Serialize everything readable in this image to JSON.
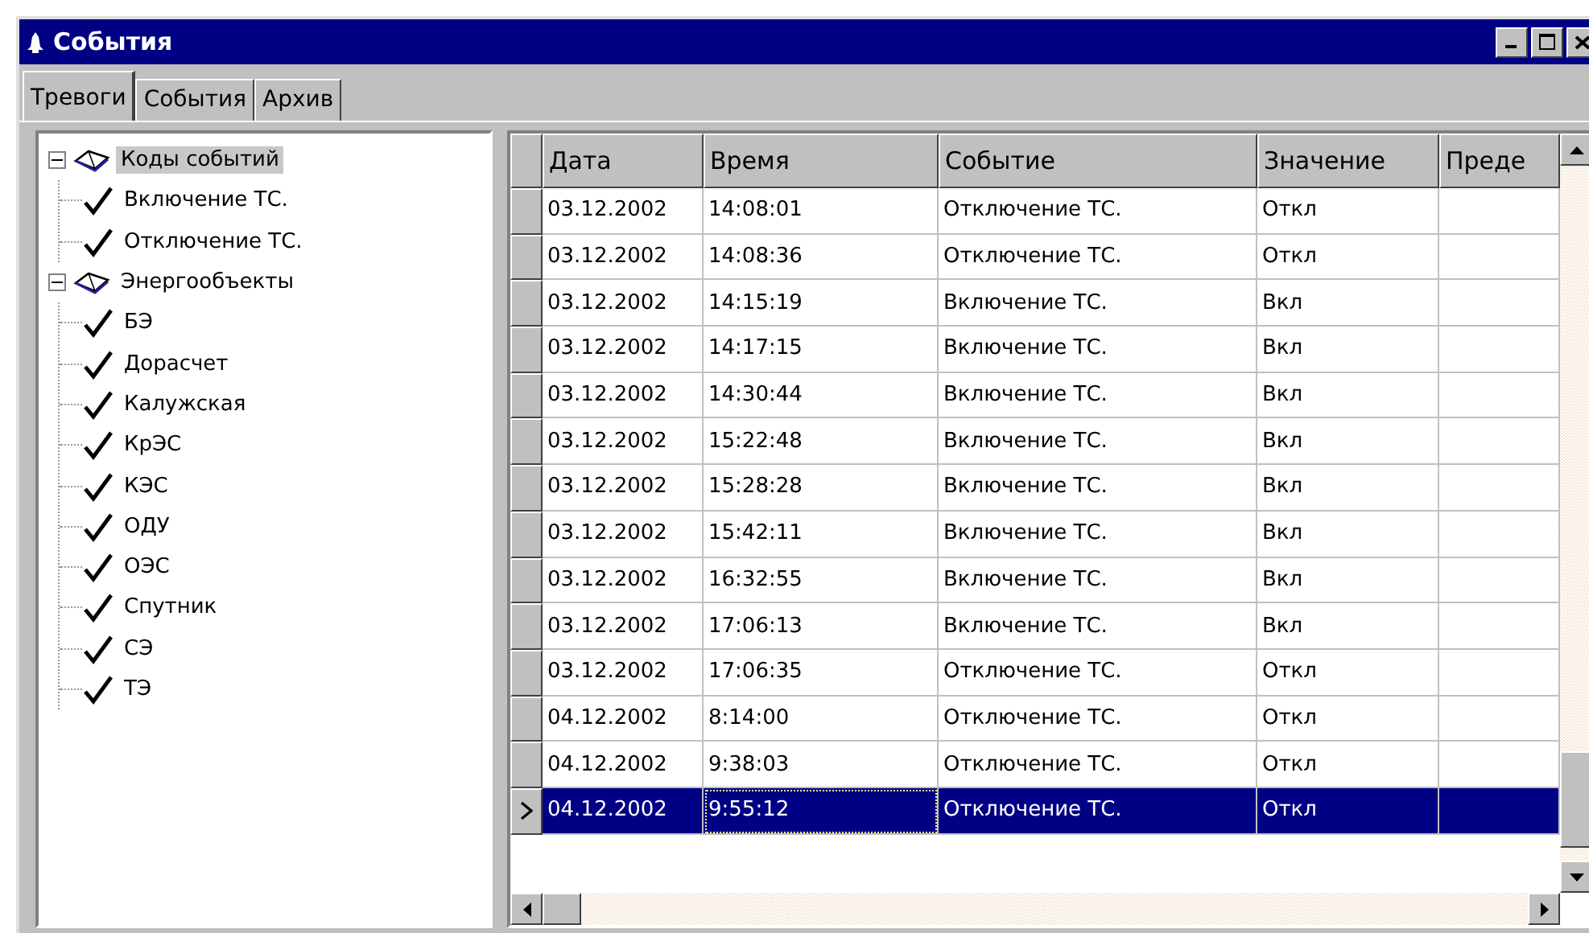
{
  "window": {
    "title": "События"
  },
  "tabs": [
    {
      "label": "Тревоги",
      "selected": true
    },
    {
      "label": "События",
      "selected": false
    },
    {
      "label": "Архив",
      "selected": false
    }
  ],
  "tree": [
    {
      "label": "Коды событий",
      "expanded": true,
      "selected": true,
      "children": [
        {
          "label": "Включение ТС.",
          "checked": true
        },
        {
          "label": "Отключение ТС.",
          "checked": true
        }
      ]
    },
    {
      "label": "Энергообъекты",
      "expanded": true,
      "selected": false,
      "children": [
        {
          "label": "БЭ",
          "checked": true
        },
        {
          "label": "Дорасчет",
          "checked": true
        },
        {
          "label": "Калужская",
          "checked": true
        },
        {
          "label": "КрЭС",
          "checked": true
        },
        {
          "label": "КЭС",
          "checked": true
        },
        {
          "label": "ОДУ",
          "checked": true
        },
        {
          "label": "ОЭС",
          "checked": true
        },
        {
          "label": "Спутник",
          "checked": true
        },
        {
          "label": "СЭ",
          "checked": true
        },
        {
          "label": "ТЭ",
          "checked": true
        }
      ]
    }
  ],
  "table": {
    "columns": [
      "Дата",
      "Время",
      "Событие",
      "Значение",
      "Преде"
    ],
    "rows": [
      {
        "cells": [
          "03.12.2002",
          "14:08:01",
          "Отключение ТС.",
          "Откл"
        ],
        "selected": false
      },
      {
        "cells": [
          "03.12.2002",
          "14:08:36",
          "Отключение ТС.",
          "Откл"
        ],
        "selected": false
      },
      {
        "cells": [
          "03.12.2002",
          "14:15:19",
          "Включение ТС.",
          "Вкл"
        ],
        "selected": false
      },
      {
        "cells": [
          "03.12.2002",
          "14:17:15",
          "Включение ТС.",
          "Вкл"
        ],
        "selected": false
      },
      {
        "cells": [
          "03.12.2002",
          "14:30:44",
          "Включение ТС.",
          "Вкл"
        ],
        "selected": false
      },
      {
        "cells": [
          "03.12.2002",
          "15:22:48",
          "Включение ТС.",
          "Вкл"
        ],
        "selected": false
      },
      {
        "cells": [
          "03.12.2002",
          "15:28:28",
          "Включение ТС.",
          "Вкл"
        ],
        "selected": false
      },
      {
        "cells": [
          "03.12.2002",
          "15:42:11",
          "Включение ТС.",
          "Вкл"
        ],
        "selected": false
      },
      {
        "cells": [
          "03.12.2002",
          "16:32:55",
          "Включение ТС.",
          "Вкл"
        ],
        "selected": false
      },
      {
        "cells": [
          "03.12.2002",
          "17:06:13",
          "Включение ТС.",
          "Вкл"
        ],
        "selected": false
      },
      {
        "cells": [
          "03.12.2002",
          "17:06:35",
          "Отключение ТС.",
          "Откл"
        ],
        "selected": false
      },
      {
        "cells": [
          "04.12.2002",
          "8:14:00",
          "Отключение ТС.",
          "Откл"
        ],
        "selected": false
      },
      {
        "cells": [
          "04.12.2002",
          "9:38:03",
          "Отключение ТС.",
          "Откл"
        ],
        "selected": false
      },
      {
        "cells": [
          "04.12.2002",
          "9:55:12",
          "Отключение ТС.",
          "Откл"
        ],
        "selected": true
      }
    ]
  }
}
